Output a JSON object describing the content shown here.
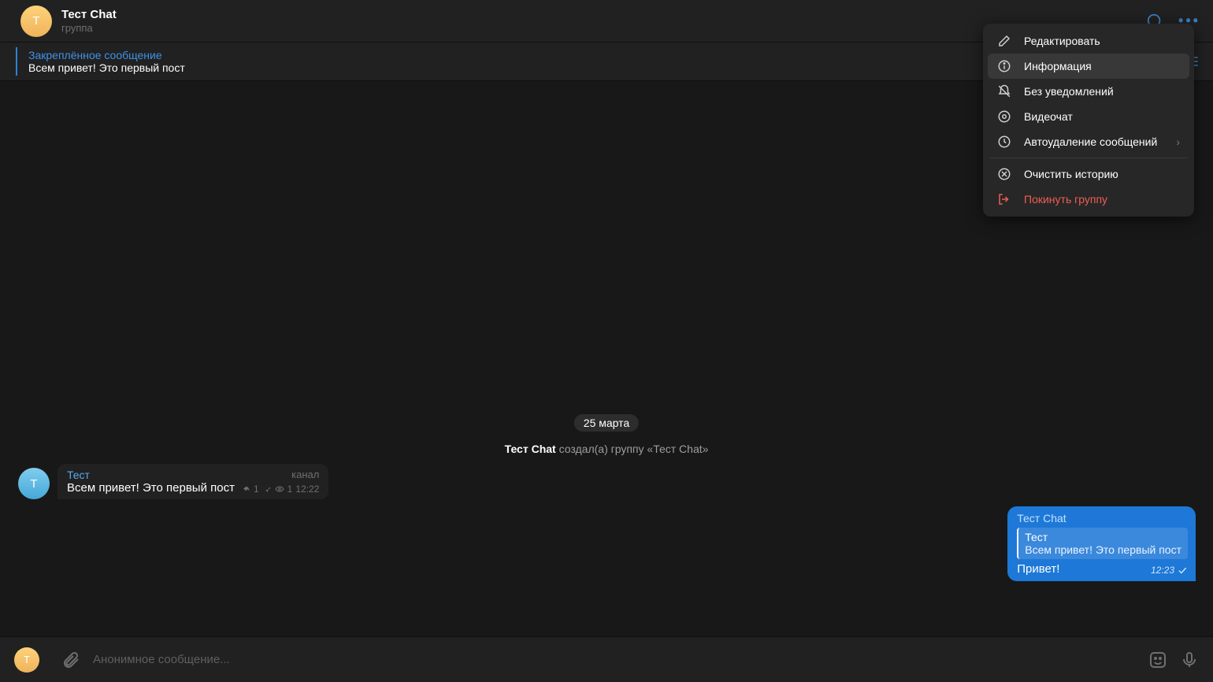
{
  "header": {
    "avatar_letter": "Т",
    "title": "Тест Chat",
    "subtitle": "группа"
  },
  "pinned": {
    "title": "Закреплённое сообщение",
    "text": "Всем привет! Это первый пост"
  },
  "date_divider": "25 марта",
  "system_message": {
    "actor": "Тест Chat",
    "rest": " создал(а) группу «Тест Chat»"
  },
  "incoming": {
    "avatar_letter": "Т",
    "sender": "Тест",
    "via": "канал",
    "body": "Всем привет! Это первый пост",
    "share_count": "1",
    "views": "1",
    "time": "12:22"
  },
  "outgoing": {
    "sender": "Тест Chat",
    "reply_sender": "Тест",
    "reply_body": "Всем привет! Это первый пост",
    "body": "Привет!",
    "time": "12:23"
  },
  "input": {
    "avatar_letter": "Т",
    "placeholder": "Анонимное сообщение..."
  },
  "menu": {
    "edit": "Редактировать",
    "info": "Информация",
    "mute": "Без уведомлений",
    "video": "Видеочат",
    "autodelete": "Автоудаление сообщений",
    "clear": "Очистить историю",
    "leave": "Покинуть группу"
  }
}
